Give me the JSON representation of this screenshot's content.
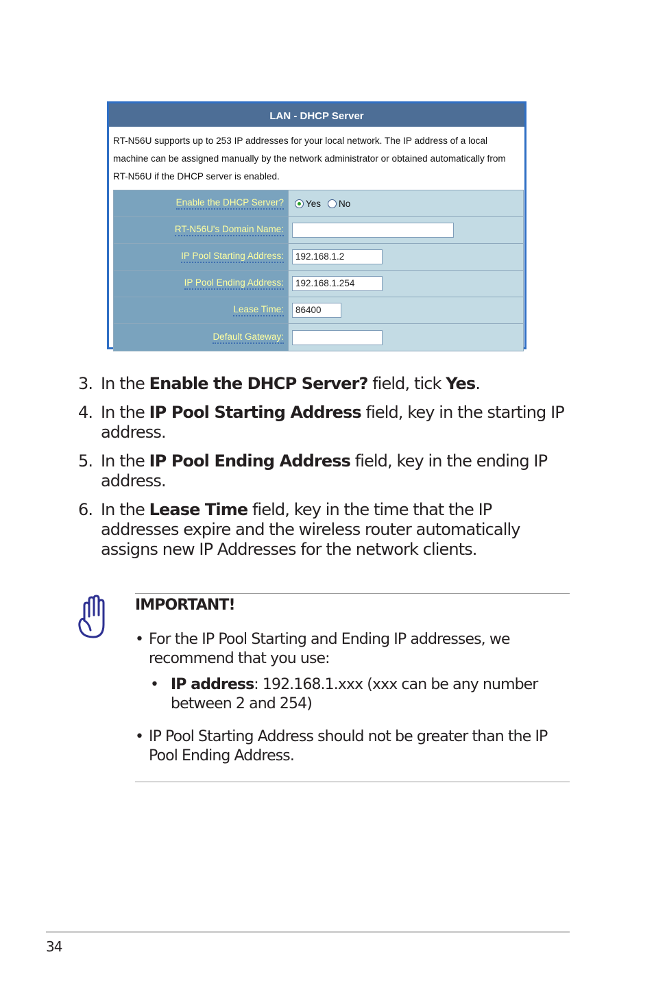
{
  "panel": {
    "title": "LAN - DHCP Server",
    "description": "RT-N56U supports up to 253 IP addresses for your local network. The IP address of a local machine can be assigned manually by the network administrator or obtained automatically from RT-N56U if the DHCP server is enabled.",
    "fields": {
      "enable_dhcp": {
        "label": "Enable the DHCP Server?",
        "options": [
          "Yes",
          "No"
        ],
        "selected": "Yes"
      },
      "domain_name": {
        "label": "RT-N56U's Domain Name:",
        "value": ""
      },
      "pool_start": {
        "label": "IP Pool Starting Address:",
        "value": "192.168.1.2"
      },
      "pool_end": {
        "label": "IP Pool Ending Address:",
        "value": "192.168.1.254"
      },
      "lease_time": {
        "label": "Lease Time:",
        "value": "86400"
      },
      "gateway": {
        "label": "Default Gateway:",
        "value": ""
      }
    }
  },
  "steps": [
    {
      "num": "3.",
      "pre": "In the ",
      "bold": "Enable the DHCP Server?",
      "mid": " field, tick ",
      "bold2": "Yes",
      "post": "."
    },
    {
      "num": "4.",
      "pre": "In the ",
      "bold": "IP Pool Starting Address",
      "post": " field, key in the starting IP address."
    },
    {
      "num": "5.",
      "pre": "In the ",
      "bold": "IP Pool Ending Address",
      "post": " field, key in the ending IP address."
    },
    {
      "num": "6.",
      "pre": "In the ",
      "bold": "Lease Time",
      "post": " field, key in the time that the IP addresses expire and the wireless router automatically assigns new IP Addresses for the network clients."
    }
  ],
  "note": {
    "icon": "hand-stop-icon",
    "title": "IMPORTANT",
    "title_suffix": "!",
    "bullet_char": "•",
    "bullet1": "For the IP Pool Starting and Ending IP addresses, we recommend that you use:",
    "sub_bullet_label": "IP address",
    "sub_bullet_text": ": 192.168.1.xxx (xxx can be any number between 2 and 254)",
    "bullet2": "IP Pool Starting Address should not be greater than the IP Pool Ending Address."
  },
  "footer": {
    "page_number": "34"
  }
}
